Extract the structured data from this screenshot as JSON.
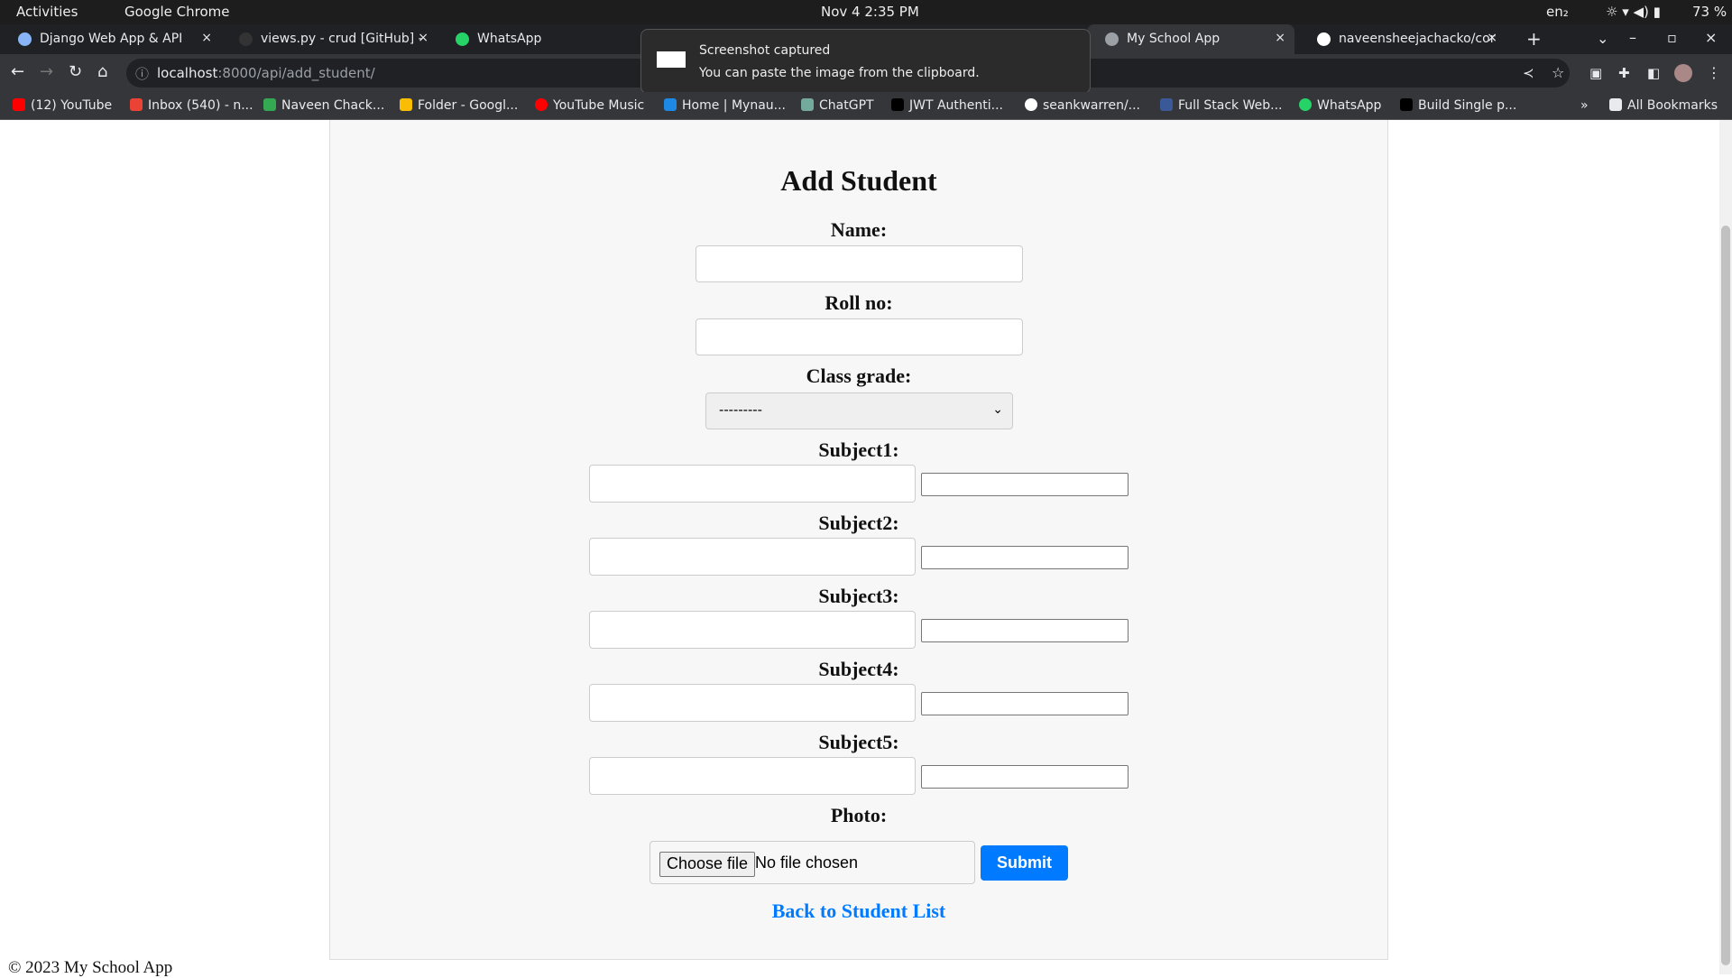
{
  "os": {
    "activities": "Activities",
    "app": "Google Chrome",
    "datetime": "Nov 4  2:35 PM",
    "lang": "en₂",
    "battery": "73 %"
  },
  "tabs": [
    {
      "label": "Django Web App & API"
    },
    {
      "label": "views.py - crud [GitHub] -"
    },
    {
      "label": "WhatsApp"
    },
    {
      "label": "My School App"
    },
    {
      "label": "naveensheejachacko/cor"
    }
  ],
  "address": {
    "host": "localhost",
    "path": ":8000/api/add_student/"
  },
  "toast": {
    "title": "Screenshot captured",
    "body": "You can paste the image from the clipboard."
  },
  "bookmarks": [
    "(12) YouTube",
    "Inbox (540) - n...",
    "Naveen Chack...",
    "Folder - Googl...",
    "YouTube Music",
    "Home | Mynau...",
    "ChatGPT",
    "JWT Authenti...",
    "seankwarren/...",
    "Full Stack Web...",
    "WhatsApp",
    "Build Single p..."
  ],
  "bookmarks_all": "All Bookmarks",
  "form": {
    "title": "Add Student",
    "name_label": "Name:",
    "roll_label": "Roll no:",
    "class_label": "Class grade:",
    "class_value": "---------",
    "subjects": [
      "Subject1:",
      "Subject2:",
      "Subject3:",
      "Subject4:",
      "Subject5:"
    ],
    "photo_label": "Photo:",
    "choose_file": "Choose file",
    "no_file": "No file chosen",
    "submit": "Submit",
    "back": "Back to Student List"
  },
  "footer": "© 2023 My School App",
  "colors": {
    "accent": "#007bff"
  }
}
